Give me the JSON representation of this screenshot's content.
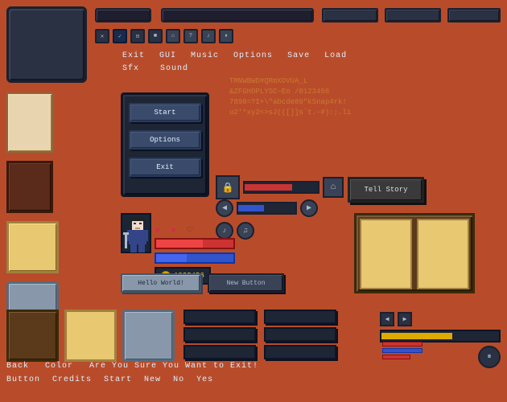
{
  "background_color": "#b84c2a",
  "top_row": {
    "buttons": [
      "",
      "",
      "",
      "",
      ""
    ],
    "nav_labels": [
      "Exit",
      "GUI",
      "Music",
      "Options",
      "Save",
      "Load"
    ],
    "nav_labels2": [
      "Sfx",
      "Sound"
    ]
  },
  "font_display": {
    "line1": "TMNWBWD#QRmXOVUA_L",
    "line2": "&ZFGHOPLYSC~Eo /0123456",
    "line3": "7890=?I+\\\"abcde89\"kSnap4rk!",
    "line4": "u2'*xy2<>sJ(([]]s`t.-#):;.li"
  },
  "menu_panel": {
    "start_label": "Start",
    "options_label": "Options",
    "exit_label": "Exit"
  },
  "tell_story": {
    "label": "Tell Story"
  },
  "coin_display": {
    "value": "1023456"
  },
  "buttons": {
    "hello_world": "Hello World!",
    "new_button": "New Button"
  },
  "bottom_labels_row1": [
    "Back",
    "Color",
    "Are You Sure You Want to Exit!",
    "",
    "",
    ""
  ],
  "bottom_labels_row2": [
    "Button",
    "Credits",
    "Start",
    "New",
    "No",
    "Yes"
  ],
  "icons": {
    "x": "✕",
    "check": "✓",
    "monitor": "⊡",
    "home": "⌂",
    "question": "?",
    "music": "♪",
    "pause": "⏸",
    "left_arrow": "◀",
    "right_arrow": "▶",
    "lock": "🔒",
    "heart_full": "♥",
    "heart_empty": "♡",
    "coin": "●",
    "audio": "♪",
    "audio2": "🎵"
  }
}
